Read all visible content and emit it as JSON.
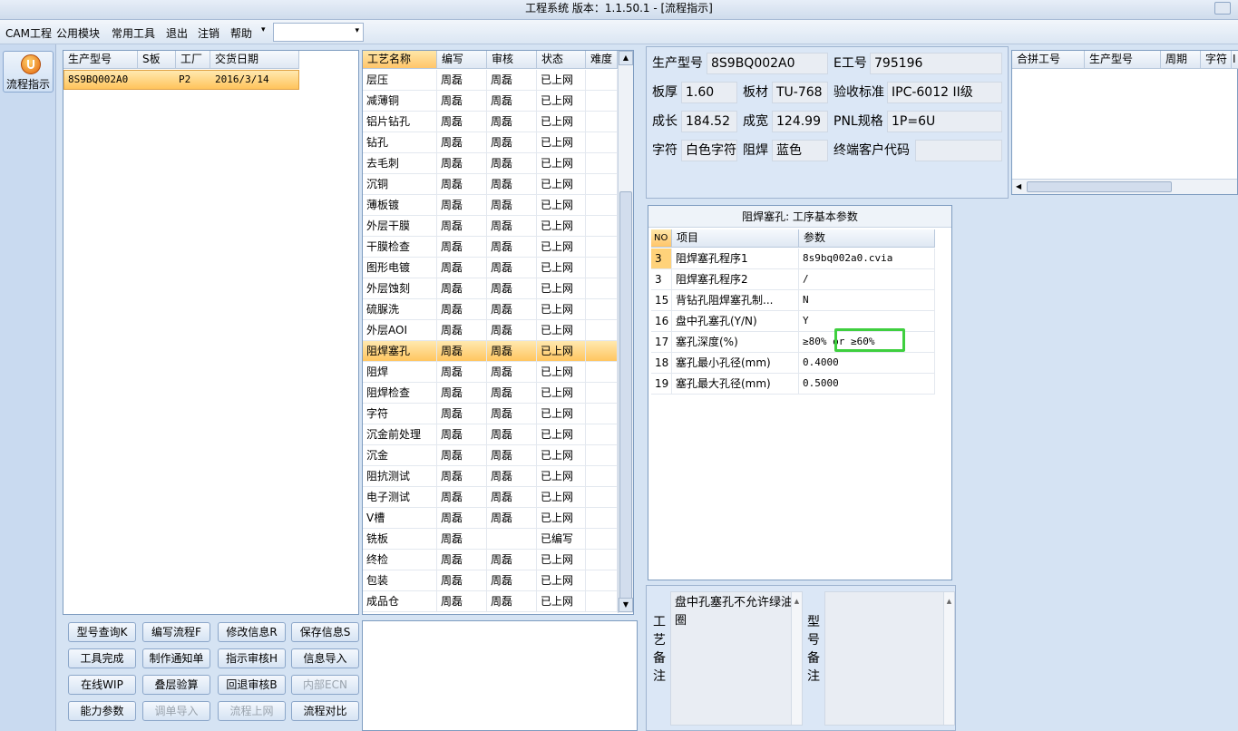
{
  "window": {
    "title": "工程系统   版本：1.1.50.1 - [流程指示]"
  },
  "menu": [
    {
      "label": "CAM工程"
    },
    {
      "label": "公用模块"
    },
    {
      "label": "常用工具"
    },
    {
      "label": "退出"
    },
    {
      "label": "注销"
    },
    {
      "label": "帮助"
    }
  ],
  "menu_arrow": "▾",
  "sidebar": {
    "flow_button_label": "流程指示"
  },
  "orders": {
    "headers": [
      "生产型号",
      "S板",
      "工厂",
      "交货日期"
    ],
    "rows": [
      {
        "model": "8S9BQ002A0",
        "s": "",
        "factory": "P2",
        "date": "2016/3/14"
      }
    ]
  },
  "processes": {
    "headers": [
      "工艺名称",
      "编写",
      "审核",
      "状态",
      "难度"
    ],
    "rows": [
      [
        "层压",
        "周磊",
        "周磊",
        "已上网",
        ""
      ],
      [
        "减薄铜",
        "周磊",
        "周磊",
        "已上网",
        ""
      ],
      [
        "铝片钻孔",
        "周磊",
        "周磊",
        "已上网",
        ""
      ],
      [
        "钻孔",
        "周磊",
        "周磊",
        "已上网",
        ""
      ],
      [
        "去毛刺",
        "周磊",
        "周磊",
        "已上网",
        ""
      ],
      [
        "沉铜",
        "周磊",
        "周磊",
        "已上网",
        ""
      ],
      [
        "薄板镀",
        "周磊",
        "周磊",
        "已上网",
        ""
      ],
      [
        "外层干膜",
        "周磊",
        "周磊",
        "已上网",
        ""
      ],
      [
        "干膜检查",
        "周磊",
        "周磊",
        "已上网",
        ""
      ],
      [
        "图形电镀",
        "周磊",
        "周磊",
        "已上网",
        ""
      ],
      [
        "外层蚀刻",
        "周磊",
        "周磊",
        "已上网",
        ""
      ],
      [
        "硫脲洗",
        "周磊",
        "周磊",
        "已上网",
        ""
      ],
      [
        "外层AOI",
        "周磊",
        "周磊",
        "已上网",
        ""
      ],
      [
        "阻焊塞孔",
        "周磊",
        "周磊",
        "已上网",
        ""
      ],
      [
        "阻焊",
        "周磊",
        "周磊",
        "已上网",
        ""
      ],
      [
        "阻焊检查",
        "周磊",
        "周磊",
        "已上网",
        ""
      ],
      [
        "字符",
        "周磊",
        "周磊",
        "已上网",
        ""
      ],
      [
        "沉金前处理",
        "周磊",
        "周磊",
        "已上网",
        ""
      ],
      [
        "沉金",
        "周磊",
        "周磊",
        "已上网",
        ""
      ],
      [
        "阻抗测试",
        "周磊",
        "周磊",
        "已上网",
        ""
      ],
      [
        "电子测试",
        "周磊",
        "周磊",
        "已上网",
        ""
      ],
      [
        "V槽",
        "周磊",
        "周磊",
        "已上网",
        ""
      ],
      [
        "铣板",
        "周磊",
        "",
        "已编写",
        ""
      ],
      [
        "终检",
        "周磊",
        "周磊",
        "已上网",
        ""
      ],
      [
        "包装",
        "周磊",
        "周磊",
        "已上网",
        ""
      ],
      [
        "成品仓",
        "周磊",
        "周磊",
        "已上网",
        ""
      ]
    ],
    "selected": "阻焊塞孔"
  },
  "buttons": [
    [
      "型号查询K",
      "编写流程F",
      "修改信息R",
      "保存信息S"
    ],
    [
      "工具完成",
      "制作通知单",
      "指示审核H",
      "信息导入"
    ],
    [
      "在线WIP",
      "叠层验算",
      "回退审核B",
      "内部ECN"
    ],
    [
      "能力参数",
      "调单导入",
      "流程上网",
      "流程对比"
    ]
  ],
  "disabled_buttons": [
    "内部ECN",
    "调单导入",
    "流程上网"
  ],
  "info": {
    "model_label": "生产型号",
    "model": "8S9BQ002A0",
    "engineer_label": "E工号",
    "engineer": "795196",
    "thickness_label": "板厚",
    "thickness": "1.60",
    "material_label": "板材",
    "material": "TU-768",
    "standard_label": "验收标准",
    "standard": "IPC-6012 II级",
    "length_label": "成长",
    "length": "184.52",
    "width_label": "成宽",
    "width": "124.99",
    "pnl_label": "PNL规格",
    "pnl": "1P=6U",
    "char_label": "字符",
    "char": "白色字符",
    "mask_label": "阻焊",
    "mask": "蓝色",
    "customer_label": "终端客户代码",
    "customer": ""
  },
  "merge": {
    "headers": [
      "合拼工号",
      "生产型号",
      "周期",
      "字符",
      "I"
    ]
  },
  "params": {
    "title": "阻焊塞孔: 工序基本参数",
    "headers": [
      "NO",
      "项目",
      "参数"
    ],
    "rows": [
      [
        "3",
        "阻焊塞孔程序1",
        "8s9bq002a0.cvia"
      ],
      [
        "3",
        "阻焊塞孔程序2",
        "/"
      ],
      [
        "15",
        "背钻孔阻焊塞孔制...",
        "N"
      ],
      [
        "16",
        "盘中孔塞孔(Y/N)",
        "Y"
      ],
      [
        "17",
        "塞孔深度(%)",
        "≥80% or ≥60%"
      ],
      [
        "18",
        "塞孔最小孔径(mm)",
        "0.4000"
      ],
      [
        "19",
        "塞孔最大孔径(mm)",
        "0.5000"
      ]
    ]
  },
  "remarks": {
    "process_label": "工艺备注",
    "process_text": "盘中孔塞孔不允许绿油圈",
    "model_label": "型号备注",
    "model_text": ""
  },
  "colors": {
    "selection": "#ffc45c",
    "highlight_box": "#3fcf3f",
    "accent": "#e2620c"
  }
}
